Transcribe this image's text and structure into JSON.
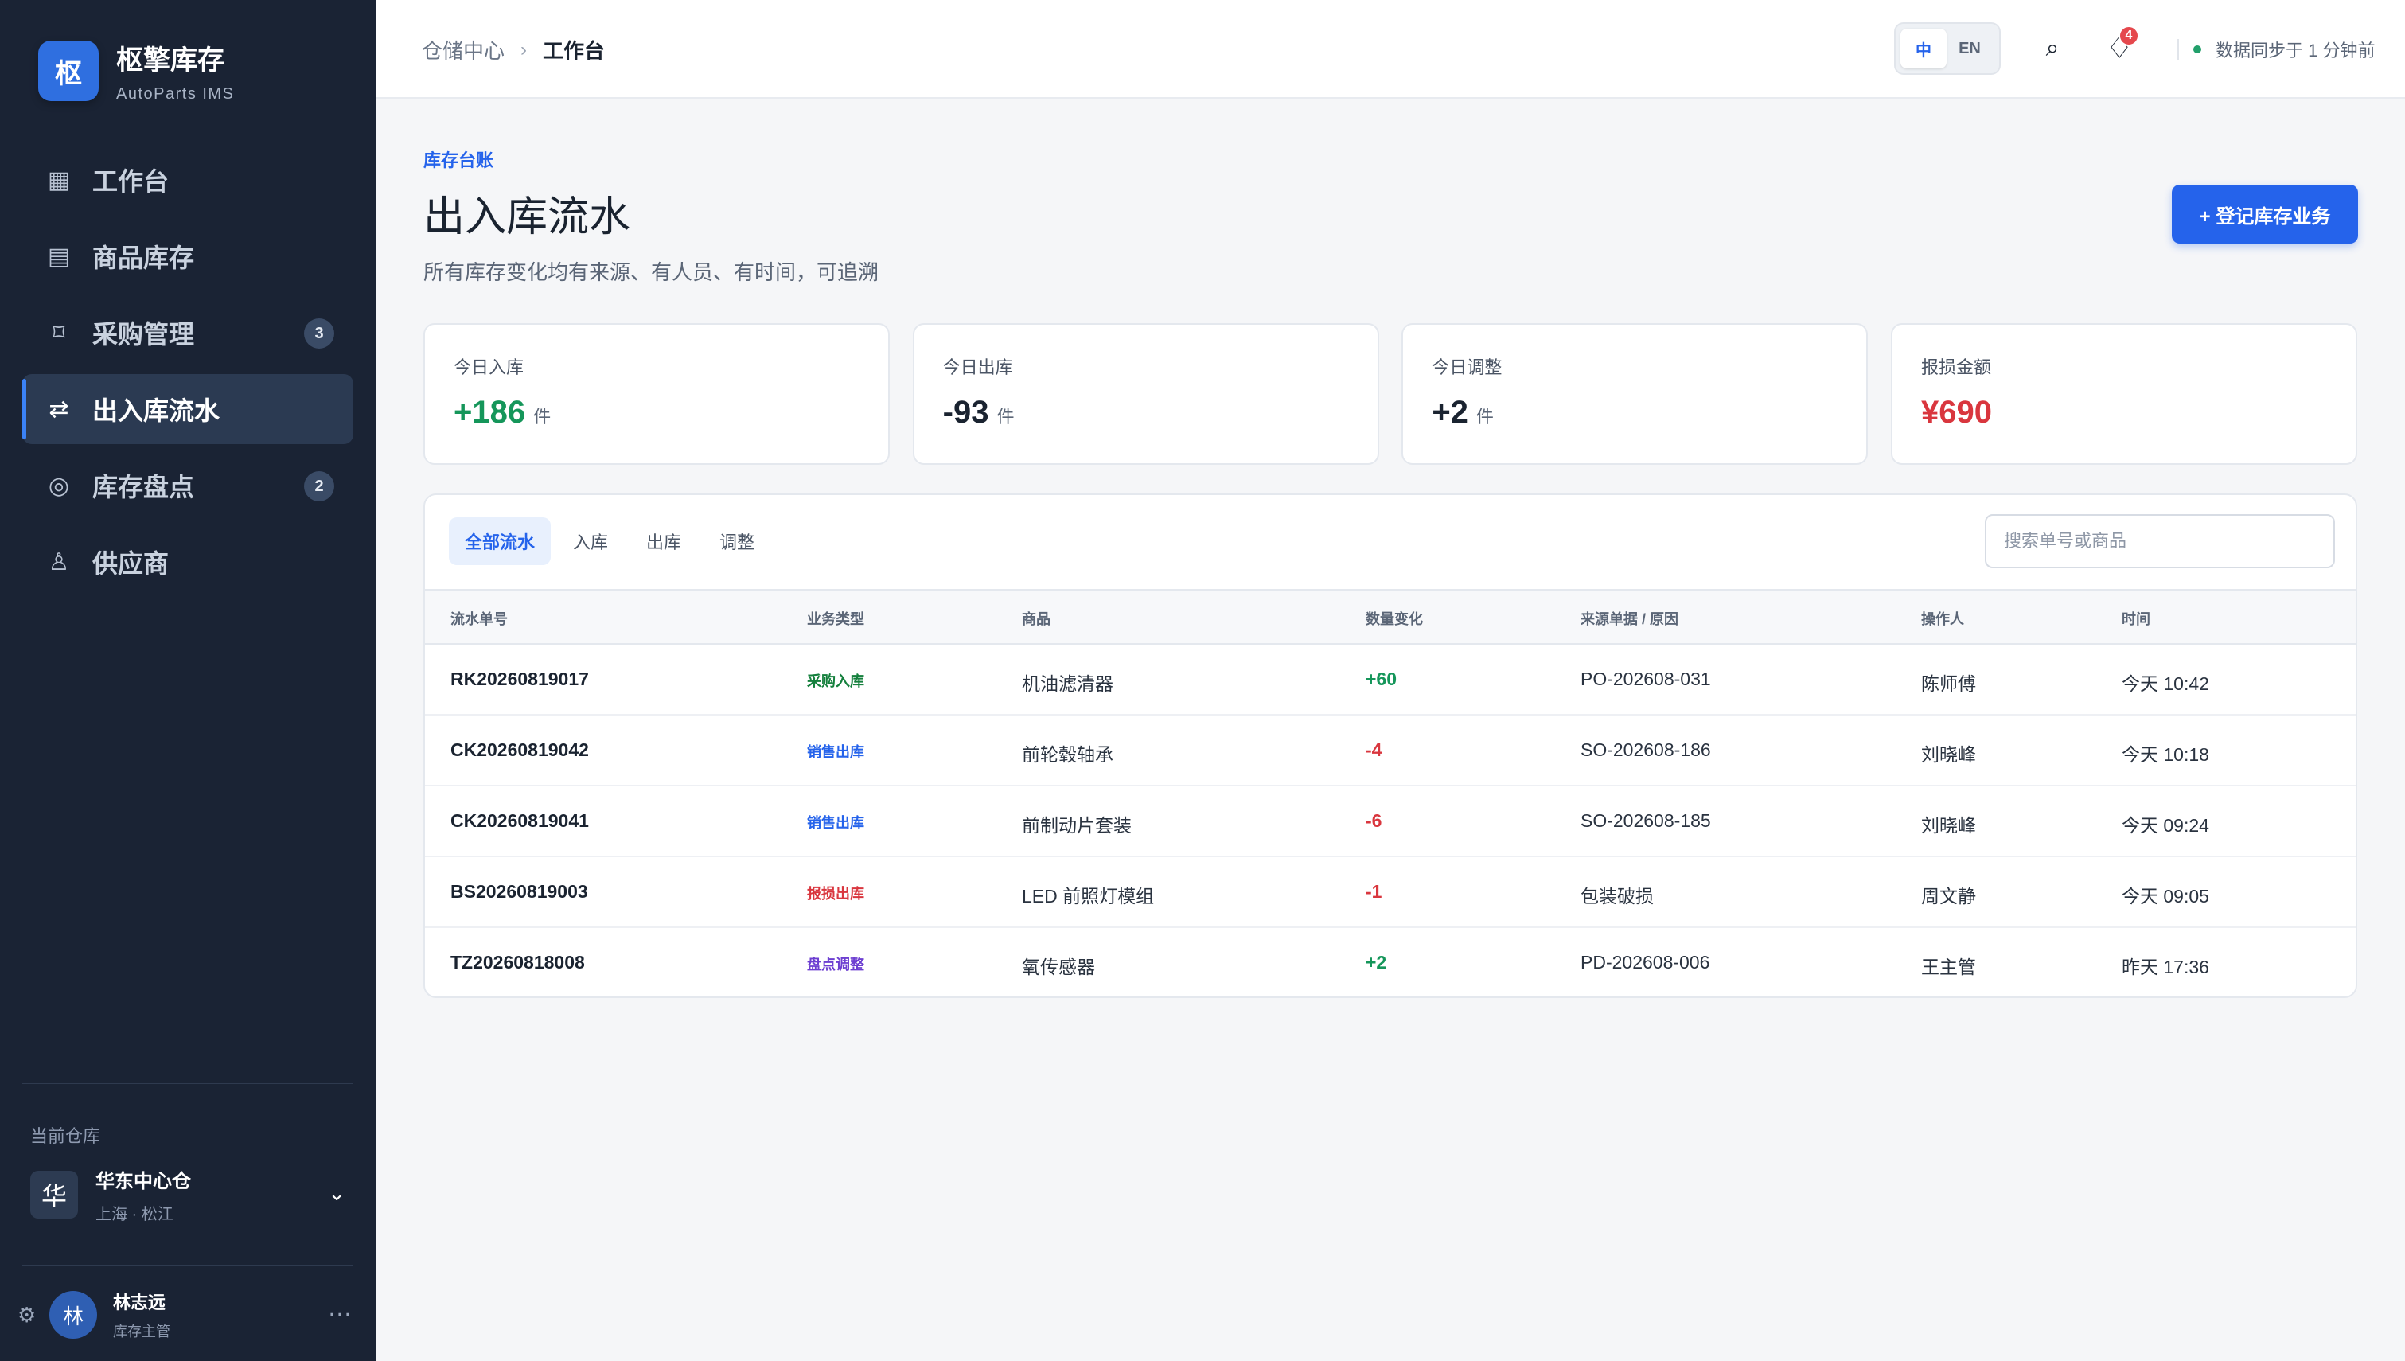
{
  "brand": {
    "logo": "枢",
    "name": "枢擎库存",
    "subtitle": "AutoParts IMS"
  },
  "nav": {
    "items": [
      {
        "icon": "▦",
        "label": "工作台",
        "badge": ""
      },
      {
        "icon": "▤",
        "label": "商品库存",
        "badge": ""
      },
      {
        "icon": "⌑",
        "label": "采购管理",
        "badge": "3"
      },
      {
        "icon": "⇄",
        "label": "出入库流水",
        "badge": "",
        "active": true
      },
      {
        "icon": "◎",
        "label": "库存盘点",
        "badge": "2"
      },
      {
        "icon": "♙",
        "label": "供应商",
        "badge": ""
      }
    ]
  },
  "warehouse": {
    "label": "当前仓库",
    "avatar": "华",
    "name": "华东中心仓",
    "location": "上海 · 松江"
  },
  "user": {
    "avatar": "林",
    "name": "林志远",
    "role": "库存主管"
  },
  "topbar": {
    "breadcrumb_parent": "仓储中心",
    "breadcrumb_current": "工作台",
    "lang_zh": "中",
    "lang_en": "EN",
    "notification_count": "4",
    "sync_status": "数据同步于 1 分钟前"
  },
  "page": {
    "eyebrow": "库存台账",
    "title": "出入库流水",
    "subtitle": "所有库存变化均有来源、有人员、有时间，可追溯",
    "primary_action": "+ 登记库存业务"
  },
  "stats": [
    {
      "label": "今日入库",
      "value": "+186",
      "unit": "件",
      "color": "#15965a"
    },
    {
      "label": "今日出库",
      "value": "-93",
      "unit": "件",
      "color": "#1a2330"
    },
    {
      "label": "今日调整",
      "value": "+2",
      "unit": "件",
      "color": "#1a2330"
    },
    {
      "label": "报损金额",
      "value": "¥690",
      "unit": "",
      "color": "#d9363e"
    }
  ],
  "filters": {
    "tabs": [
      "全部流水",
      "入库",
      "出库",
      "调整"
    ],
    "active_tab": 0,
    "search_placeholder": "搜索单号或商品",
    "search_value": ""
  },
  "table": {
    "columns": [
      "流水单号",
      "业务类型",
      "商品",
      "数量变化",
      "来源单据 / 原因",
      "操作人",
      "时间"
    ],
    "rows": [
      {
        "id": "RK20260819017",
        "type": "采购入库",
        "type_color": "#15803d",
        "product": "机油滤清器",
        "qty": "+60",
        "qty_color": "#15965a",
        "source": "PO-202608-031",
        "operator": "陈师傅",
        "time": "今天 10:42"
      },
      {
        "id": "CK20260819042",
        "type": "销售出库",
        "type_color": "#2563eb",
        "product": "前轮毂轴承",
        "qty": "-4",
        "qty_color": "#d9363e",
        "source": "SO-202608-186",
        "operator": "刘晓峰",
        "time": "今天 10:18"
      },
      {
        "id": "CK20260819041",
        "type": "销售出库",
        "type_color": "#2563eb",
        "product": "前制动片套装",
        "qty": "-6",
        "qty_color": "#d9363e",
        "source": "SO-202608-185",
        "operator": "刘晓峰",
        "time": "今天 09:24"
      },
      {
        "id": "BS20260819003",
        "type": "报损出库",
        "type_color": "#d9363e",
        "product": "LED 前照灯模组",
        "qty": "-1",
        "qty_color": "#d9363e",
        "source": "包装破损",
        "operator": "周文静",
        "time": "今天 09:05"
      },
      {
        "id": "TZ20260818008",
        "type": "盘点调整",
        "type_color": "#6d3fd1",
        "product": "氧传感器",
        "qty": "+2",
        "qty_color": "#15965a",
        "source": "PD-202608-006",
        "operator": "王主管",
        "time": "昨天 17:36"
      }
    ]
  }
}
